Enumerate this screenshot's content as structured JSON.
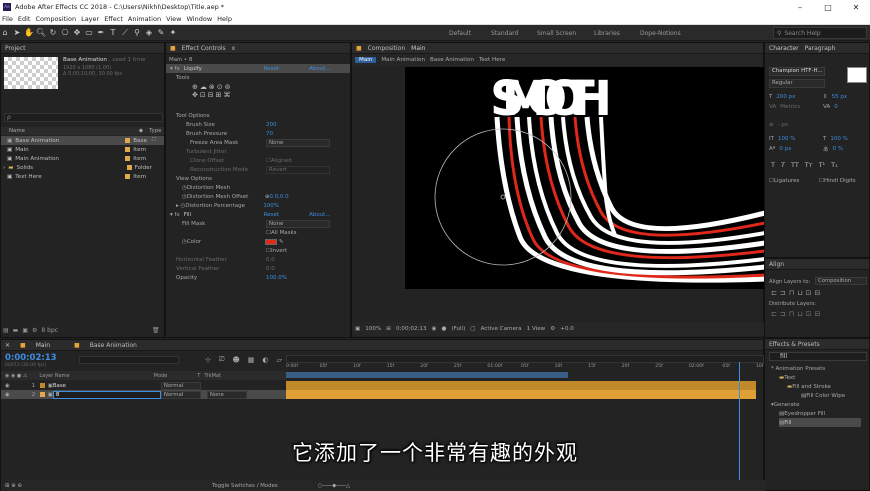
{
  "window": {
    "title": "Adobe After Effects CC 2018 - C:\\Users\\NikhI\\Desktop\\Title.aep *",
    "logo": "Ae"
  },
  "menu": [
    "File",
    "Edit",
    "Composition",
    "Layer",
    "Effect",
    "Animation",
    "View",
    "Window",
    "Help"
  ],
  "workspaces": [
    "Default",
    "Standard",
    "Small Screen",
    "Libraries",
    "Dope-Notions"
  ],
  "search_help": "Search Help",
  "project": {
    "tab": "Project",
    "comp_name": "Base Animation",
    "used": ", used 1 time",
    "info1": "1920 x 1080 (1.00)",
    "info2": "Δ 0;00;10;00, 30.00 fps",
    "search_placeholder": "ρ",
    "col_name": "Name",
    "col_type": "Type",
    "items": [
      {
        "name": "Base Animation",
        "type": "Base",
        "selected": true
      },
      {
        "name": "Main",
        "type": "Item"
      },
      {
        "name": "Main Animation",
        "type": "Item"
      },
      {
        "name": "Solids",
        "type": "Folder"
      },
      {
        "name": "Text Here",
        "type": "Item"
      }
    ],
    "bpc": "8 bpc"
  },
  "effects": {
    "tab": "Effect Controls",
    "tab_target": "x",
    "breadcrumb": "Main • 8",
    "liquify": {
      "name": "Liquify",
      "reset": "Reset",
      "about": "About..."
    },
    "tools_label": "Tools",
    "tool_options": "Tool Options",
    "brush_size_label": "Brush Size",
    "brush_size": "200",
    "brush_pressure_label": "Brush Pressure",
    "brush_pressure": "70",
    "freeze_label": "Freeze Area Mask",
    "freeze_val": "None",
    "turbulent_label": "Turbulent Jitter",
    "clone_label": "Clone Offset",
    "aligned": "Aligned",
    "reconstruction_label": "Reconstruction Mode",
    "reconstruction_val": "Revert",
    "view_options": "View Options",
    "mesh_label": "Distortion Mesh",
    "mesh_offset_label": "Distortion Mesh Offset",
    "mesh_offset": "0.0,0.0",
    "percentage_label": "Distortion Percentage",
    "percentage": "100%",
    "fill": {
      "name": "Fill",
      "reset": "Reset",
      "about": "About..."
    },
    "fill_mask_label": "Fill Mask",
    "fill_mask": "None",
    "all_masks": "All Masks",
    "color_label": "Color",
    "invert": "Invert",
    "hfeather_label": "Horizontal Feather",
    "hfeather": "0.0",
    "vfeather_label": "Vertical Feather",
    "vfeather": "0.0",
    "opacity_label": "Opacity",
    "opacity": "100.0%",
    "fill_color": "#e02a1a"
  },
  "viewer": {
    "tab": "Composition",
    "tab_name": "Main",
    "crumbs": [
      "Main",
      "Main Animation",
      "Base Animation",
      "Text Here"
    ],
    "zoom": "100%",
    "timecode": "0;00;02;13",
    "quality": "(Full)",
    "camera": "Active Camera",
    "view": "1 View",
    "exposure": "+0.0",
    "comp_text": "SMOOTH"
  },
  "character": {
    "tab": "Character",
    "tab2": "Paragraph",
    "font": "Champion HTF-H...",
    "style": "Regular",
    "size": "200 px",
    "leading": "55 px",
    "kerning": "Metrics",
    "tracking": "0",
    "indent": "- px",
    "vscale": "100 %",
    "hscale": "100 %",
    "baseline": "0 px",
    "tsume": "0 %",
    "ligatures": "Ligatures",
    "hindi": "Hindi Digits"
  },
  "align": {
    "tab": "Align",
    "align_to_label": "Align Layers to:",
    "align_to": "Composition",
    "distribute": "Distribute Layers:"
  },
  "presets": {
    "tab": "Effects & Presets",
    "search": "fill",
    "tree": [
      "* Animation Presets",
      "Text",
      "Fill and Stroke",
      "Fill Color Wipe",
      "Generate",
      "Eyedropper Fill",
      "Fill"
    ]
  },
  "timeline": {
    "tab": "Main",
    "tab2": "Base Animation",
    "timecode": "0:00:02:13",
    "frames": "00073 (30.00 fps)",
    "col_layer": "Layer Name",
    "col_mode": "Mode",
    "col_t": "T",
    "col_trkmat": "TrkMat",
    "col_parent": "Parent",
    "layers": [
      {
        "num": "1",
        "name": "Base",
        "mode": "Normal",
        "parent": ""
      },
      {
        "num": "2",
        "name": "8",
        "mode": "Normal",
        "parent": "None"
      }
    ],
    "ruler": [
      "0:00f",
      "05f",
      "10f",
      "15f",
      "20f",
      "25f",
      "01:00f",
      "05f",
      "10f",
      "15f",
      "20f",
      "25f",
      "02:00f",
      "05f",
      "10f"
    ],
    "toggle": "Toggle Switches / Modes"
  },
  "subtitle": "它添加了一个非常有趣的外观"
}
